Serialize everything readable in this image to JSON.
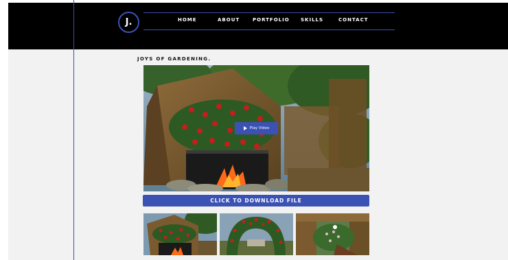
{
  "header": {
    "logo_text": "J.",
    "nav": [
      {
        "label": "HOME"
      },
      {
        "label": "ABOUT"
      },
      {
        "label": "PORTFOLIO"
      },
      {
        "label": "SKILLS"
      },
      {
        "label": "CONTACT"
      }
    ]
  },
  "main": {
    "title": "JOYS OF GARDENING.",
    "play_label": "Play Video",
    "download_label": "CLICK TO DOWNLOAD FILE"
  },
  "colors": {
    "accent": "#3b52b4",
    "header_bg": "#000000",
    "page_bg": "#f2f2f2"
  }
}
